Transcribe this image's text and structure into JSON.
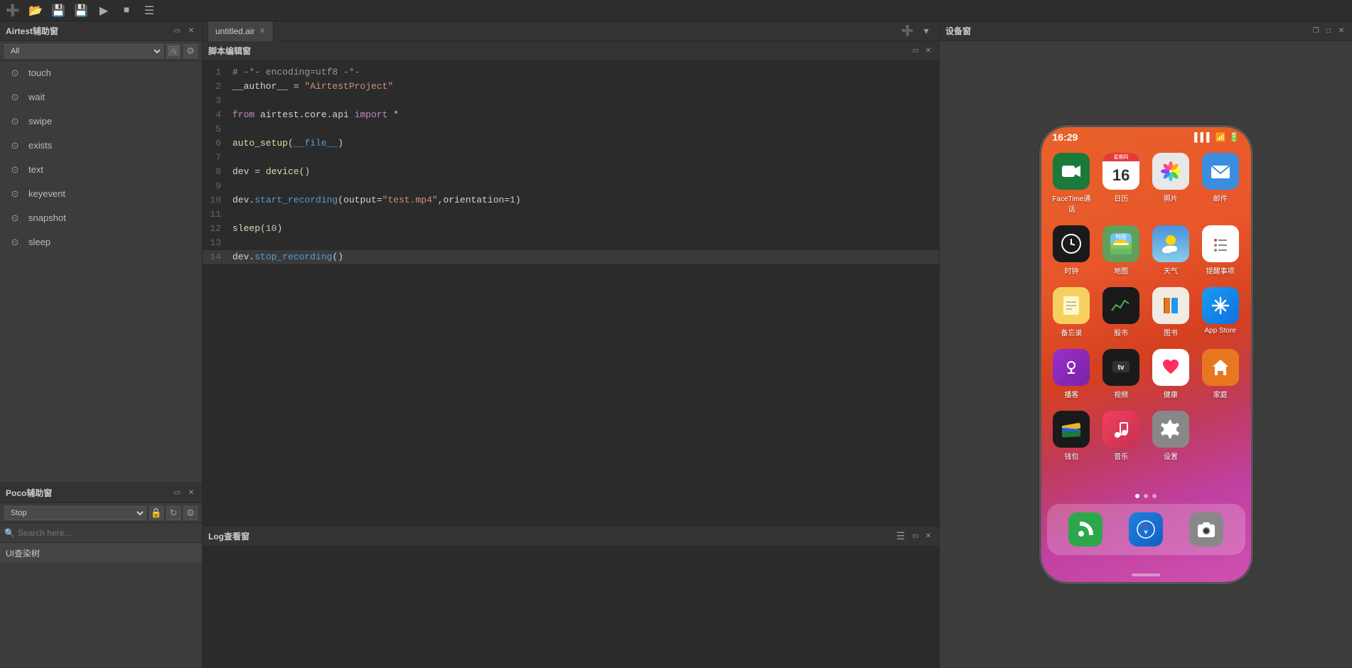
{
  "toolbar": {
    "icons": [
      "new",
      "open",
      "save",
      "save-as",
      "run",
      "stop",
      "log"
    ]
  },
  "airtest_panel": {
    "title": "Airtest辅助窗",
    "filter_label": "All",
    "api_items": [
      {
        "icon": "👆",
        "label": "touch"
      },
      {
        "icon": "⏱",
        "label": "wait"
      },
      {
        "icon": "👇",
        "label": "swipe"
      },
      {
        "icon": "🔍",
        "label": "exists"
      },
      {
        "icon": "📝",
        "label": "text"
      },
      {
        "icon": "⌨",
        "label": "keyevent"
      },
      {
        "icon": "📷",
        "label": "snapshot"
      },
      {
        "icon": "💤",
        "label": "sleep"
      }
    ]
  },
  "poco_panel": {
    "title": "Poco辅助窗",
    "dropdown_value": "Stop",
    "search_placeholder": "Search here...",
    "tree_item": "UI查染树"
  },
  "editor": {
    "title": "脚本编辑窗",
    "tab_name": "untitled.air",
    "code_lines": [
      {
        "num": 1,
        "content": "# -*- encoding=utf8 -*-",
        "type": "comment"
      },
      {
        "num": 2,
        "content": "__author__ = \"AirtestProject\"",
        "type": "string"
      },
      {
        "num": 3,
        "content": "",
        "type": "plain"
      },
      {
        "num": 4,
        "content": "from airtest.core.api import *",
        "type": "import"
      },
      {
        "num": 5,
        "content": "",
        "type": "plain"
      },
      {
        "num": 6,
        "content": "auto_setup(__file__)",
        "type": "func"
      },
      {
        "num": 7,
        "content": "",
        "type": "plain"
      },
      {
        "num": 8,
        "content": "dev = device()",
        "type": "func"
      },
      {
        "num": 9,
        "content": "",
        "type": "plain"
      },
      {
        "num": 10,
        "content": "dev.start_recording(output=\"test.mp4\",orientation=1)",
        "type": "func"
      },
      {
        "num": 11,
        "content": "",
        "type": "plain"
      },
      {
        "num": 12,
        "content": "sleep(10)",
        "type": "func"
      },
      {
        "num": 13,
        "content": "",
        "type": "plain"
      },
      {
        "num": 14,
        "content": "dev.stop_recording()",
        "type": "func"
      }
    ]
  },
  "log_panel": {
    "title": "Log查看窗"
  },
  "device_panel": {
    "title": "设备窗"
  },
  "phone": {
    "time": "16:29",
    "apps_row1": [
      {
        "icon": "facetime",
        "label": "FaceTime通话",
        "bg": "#1a7a3a"
      },
      {
        "icon": "calendar",
        "label": "日历",
        "bg": "#ffffff"
      },
      {
        "icon": "photos",
        "label": "照片",
        "bg": "#e0e0e0"
      },
      {
        "icon": "mail",
        "label": "邮件",
        "bg": "#3b8de0"
      }
    ],
    "apps_row2": [
      {
        "icon": "clock",
        "label": "时钟",
        "bg": "#1a1a1a"
      },
      {
        "icon": "maps",
        "label": "地图",
        "bg": "#5fa05a"
      },
      {
        "icon": "weather",
        "label": "天气",
        "bg": "#5090d0"
      },
      {
        "icon": "reminders",
        "label": "提醒事项",
        "bg": "#ffffff"
      }
    ],
    "apps_row3": [
      {
        "icon": "notes",
        "label": "备忘录",
        "bg": "#f5d060"
      },
      {
        "icon": "stocks",
        "label": "股市",
        "bg": "#1a1a1a"
      },
      {
        "icon": "books",
        "label": "图书",
        "bg": "#f0f0f0"
      },
      {
        "icon": "appstore",
        "label": "App Store",
        "bg": "#1070e0"
      }
    ],
    "apps_row4": [
      {
        "icon": "podcasts",
        "label": "播客",
        "bg": "#9b30c8"
      },
      {
        "icon": "appletv",
        "label": "视频",
        "bg": "#1a1a1a"
      },
      {
        "icon": "health",
        "label": "健康",
        "bg": "#ff3060"
      },
      {
        "icon": "home",
        "label": "家庭",
        "bg": "#e87820"
      }
    ],
    "apps_row5": [
      {
        "icon": "wallet",
        "label": "钱包",
        "bg": "#1a1a1a"
      },
      {
        "icon": "music",
        "label": "音乐",
        "bg": "#f04060"
      },
      {
        "icon": "settings",
        "label": "设置",
        "bg": "#888888"
      },
      {
        "icon": "",
        "label": ""
      }
    ],
    "dock": [
      {
        "icon": "phone",
        "label": "电话",
        "bg": "#2ca84a"
      },
      {
        "icon": "safari",
        "label": "Safari",
        "bg": "#2060c0"
      },
      {
        "icon": "camera",
        "label": "相机",
        "bg": "#888888"
      }
    ]
  }
}
